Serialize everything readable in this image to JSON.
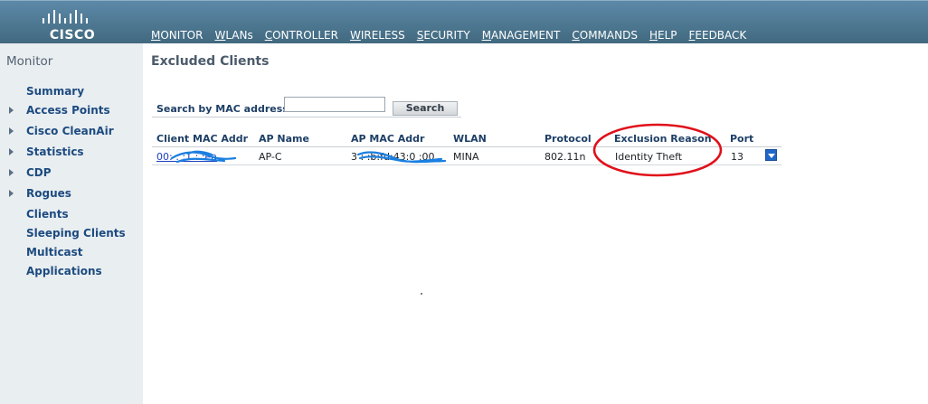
{
  "brand": {
    "logo_text": "CISCO"
  },
  "nav": {
    "items": [
      {
        "first": "M",
        "rest": "ONITOR"
      },
      {
        "first": "W",
        "rest": "LANs"
      },
      {
        "first": "C",
        "rest": "ONTROLLER"
      },
      {
        "first": "W",
        "rest": "IRELESS"
      },
      {
        "first": "S",
        "rest": "ECURITY"
      },
      {
        "first": "M",
        "rest": "ANAGEMENT"
      },
      {
        "first": "C",
        "rest": "OMMANDS"
      },
      {
        "first": "H",
        "rest": "ELP"
      },
      {
        "first": "F",
        "rest": "EEDBACK"
      }
    ]
  },
  "sidebar": {
    "title": "Monitor",
    "items": [
      {
        "label": "Summary"
      },
      {
        "label": "Access Points"
      },
      {
        "label": "Cisco CleanAir"
      },
      {
        "label": "Statistics"
      },
      {
        "label": "CDP"
      },
      {
        "label": "Rogues"
      },
      {
        "label": "Clients"
      },
      {
        "label": "Sleeping Clients"
      },
      {
        "label": "Multicast"
      },
      {
        "label": "Applications"
      }
    ]
  },
  "main": {
    "title": "Excluded Clients",
    "search": {
      "label": "Search by MAC address",
      "value": "",
      "button_label": "Search"
    },
    "table": {
      "headers": [
        "Client MAC Addr",
        "AP Name",
        "AP MAC Addr",
        "WLAN",
        "Protocol",
        "Exclusion Reason",
        "Port"
      ],
      "rows": [
        {
          "client_mac": "00:   :   :1 :      :ea",
          "ap_name": "AP-C",
          "ap_mac": "3 :   :b:fd:43:0 :00",
          "wlan": "MINA",
          "protocol": "802.11n",
          "exclusion_reason": "Identity Theft",
          "port": "13"
        }
      ]
    }
  },
  "colors": {
    "banner": "#4f7b96",
    "sidebar": "#e9eef1",
    "link": "#1a3fbf",
    "scribble": "#1a7fe0",
    "annotation": "#e0101a"
  }
}
